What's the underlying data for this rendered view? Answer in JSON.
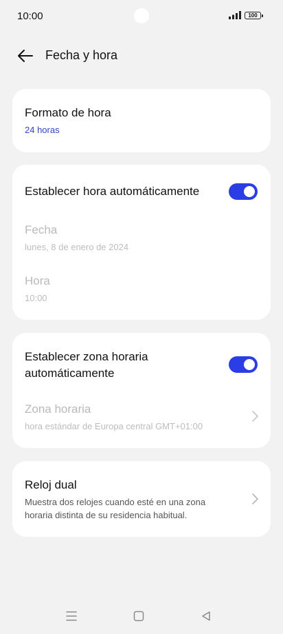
{
  "status_bar": {
    "time": "10:00",
    "battery": "100",
    "icons": [
      "signal-icon",
      "battery-icon"
    ]
  },
  "header": {
    "title": "Fecha y hora",
    "back_icon": "arrow-left-icon"
  },
  "time_format": {
    "title": "Formato de hora",
    "value": "24 horas"
  },
  "auto_time": {
    "title": "Establecer hora automáticamente",
    "enabled": true,
    "date_title": "Fecha",
    "date_value": "lunes, 8 de enero de 2024",
    "time_title": "Hora",
    "time_value": "10:00"
  },
  "auto_timezone": {
    "title_line1": "Establecer zona horaria",
    "title_line2": "automáticamente",
    "enabled": true,
    "zone_title": "Zona horaria",
    "zone_value": "hora estándar de Europa central GMT+01:00"
  },
  "dual_clock": {
    "title": "Reloj dual",
    "desc_line1": "Muestra dos relojes cuando esté en una zona",
    "desc_line2": "horaria distinta de su residencia habitual."
  },
  "nav_bar": {
    "icons": [
      "menu-icon",
      "home-icon",
      "back-triangle-icon"
    ]
  },
  "colors": {
    "accent": "#2b3ee6",
    "link": "#2f46c6",
    "background": "#f2f2f3",
    "card": "#ffffff"
  }
}
